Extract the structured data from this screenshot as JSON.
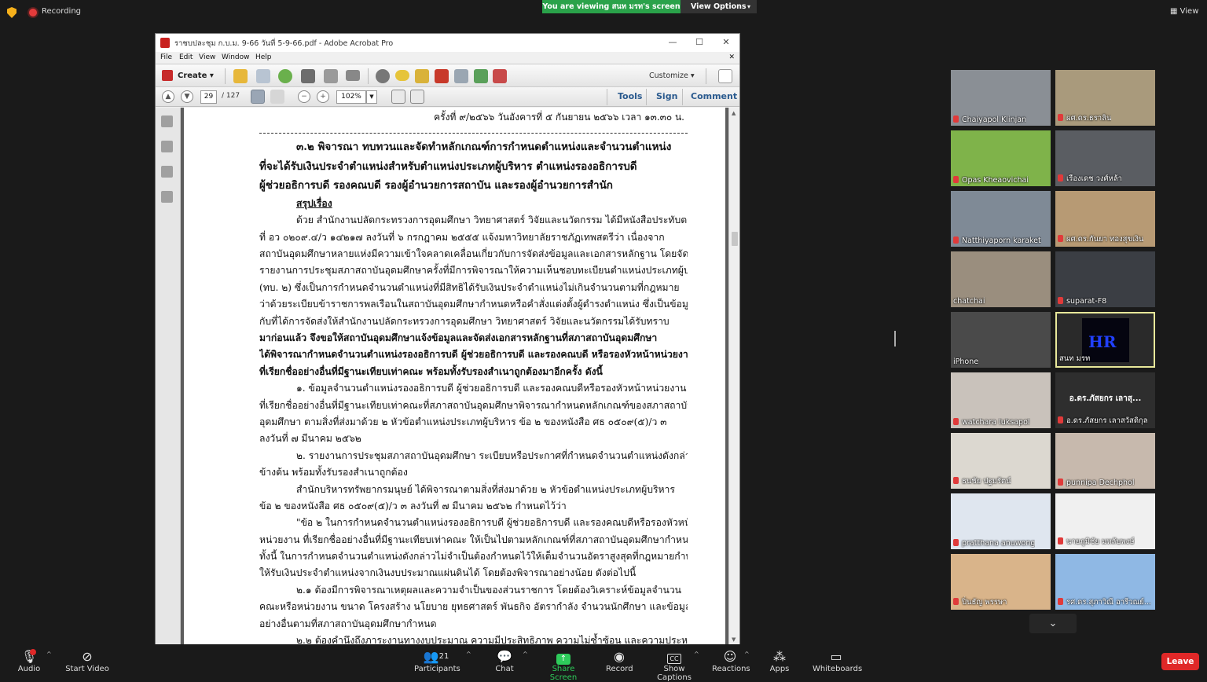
{
  "topbar": {
    "recording": "Recording",
    "viewing": "You are viewing สนท มรท's screen",
    "view_options": "View Options",
    "view": "View"
  },
  "acrobat": {
    "title": "ราชบปละชุม ก.บ.ม. 9-66 วันที่ 5-9-66.pdf - Adobe Acrobat Pro",
    "menu": [
      "File",
      "Edit",
      "View",
      "Window",
      "Help"
    ],
    "create": "Create",
    "customize": "Customize",
    "page_current": "29",
    "page_total": "/ 127",
    "zoom": "102%",
    "tabs": [
      "Tools",
      "Sign",
      "Comment"
    ]
  },
  "document": {
    "header": "ครั้งที่ ๙/๒๕๖๖ วันอังคารที่ ๕ กันยายน ๒๕๖๖ เวลา ๑๓.๓๐ น.",
    "heading": [
      "๓.๒   พิจารณา ทบทวนและจัดทำหลักเกณฑ์การกำหนดตำแหน่งและจำนวนตำแหน่ง",
      "ที่จะได้รับเงินประจำตำแหน่งสำหรับตำแหน่งประเภทผู้บริหาร ตำแหน่งรองอธิการบดี",
      "ผู้ช่วยอธิการบดี รองคณบดี รองผู้อำนวยการสถาบัน และรองผู้อำนวยการสำนัก"
    ],
    "summary_label": "สรุปเรื่อง",
    "lines": [
      "ด้วย สำนักงานปลัดกระทรวงการอุดมศึกษา วิทยาศาสตร์ วิจัยและนวัตกรรม ได้มีหนังสือประทับตรา",
      "ที่ อว ๐๒๐๙.๔/ว ๑๔๒๑๗ ลงวันที่ ๖ กรกฎาคม ๒๕๕๕ แจ้งมหาวิทยาลัยราชภัฏเทพสตรีว่า เนื่องจาก",
      "สถาบันอุดมศึกษาหลายแห่งมีความเข้าใจคลาดเคลื่อนเกี่ยวกับการจัดส่งข้อมูลและเอกสารหลักฐาน โดยจัดส่ง",
      "รายงานการประชุมสภาสถาบันอุดมศึกษาครั้งที่มีการพิจารณาให้ความเห็นชอบทะเบียนตำแหน่งประเภทผู้บริหาร",
      "(ทบ. ๒) ซึ่งเป็นการกำหนดจำนวนตำแหน่งที่มีสิทธิได้รับเงินประจำตำแหน่งไม่เกินจำนวนตามที่กฎหมาย",
      "ว่าด้วยระเบียบข้าราชการพลเรือนในสถาบันอุดมศึกษากำหนดหรือคำสั่งแต่งตั้งผู้ดำรงตำแหน่ง ซึ่งเป็นข้อมูลซ้ำ",
      "กับที่ได้การจัดส่งให้สำนักงานปลัดกระทรวงการอุดมศึกษา วิทยาศาสตร์ วิจัยและนวัตกรรมได้รับทราบ",
      "มาก่อนแล้ว จึงขอให้สถาบันอุดมศึกษาแจ้งข้อมูลและจัดส่งเอกสารหลักฐานที่สภาสถาบันอุดมศึกษา",
      "ได้พิจารณากำหนดจำนวนตำแหน่งรองอธิการบดี ผู้ช่วยอธิการบดี และรองคณบดี หรือรองหัวหน้าหน่วยงาน",
      "ที่เรียกชื่ออย่างอื่นที่มีฐานะเทียบเท่าคณะ พร้อมทั้งรับรองสำเนาถูกต้องมาอีกครั้ง ดังนี้",
      "๑. ข้อมูลจำนวนตำแหน่งรองอธิการบดี ผู้ช่วยอธิการบดี และรองคณบดีหรือรองหัวหน้าหน่วยงาน",
      "ที่เรียกชื่ออย่างอื่นที่มีฐานะเทียบเท่าคณะที่สภาสถาบันอุดมศึกษาพิจารณากำหนดหลักเกณฑ์ของสภาสถาบัน",
      "อุดมศึกษา ตามสิ่งที่ส่งมาด้วย ๒ หัวข้อตำแหน่งประเภทผู้บริหาร ข้อ ๒ ของหนังสือ ศธ ๐๕๐๙(๕)/ว ๓",
      "ลงวันที่ ๗ มีนาคม ๒๕๖๒",
      "๒. รายงานการประชุมสภาสถาบันอุดมศึกษา ระเบียบหรือประกาศที่กำหนดจำนวนตำแหน่งดังกล่าว",
      "ข้างต้น พร้อมทั้งรับรองสำเนาถูกต้อง",
      "สำนักบริหารทรัพยากรมนุษย์ ได้พิจารณาตามสิ่งที่ส่งมาด้วย ๒ หัวข้อตำแหน่งประเภทผู้บริหาร",
      "ข้อ ๒ ของหนังสือ ศธ ๐๕๐๙(๕)/ว ๓ ลงวันที่ ๗ มีนาคม ๒๕๖๒ กำหนดไว้ว่า",
      "\"ข้อ ๒ ในการกำหนดจำนวนตำแหน่งรองอธิการบดี ผู้ช่วยอธิการบดี และรองคณบดีหรือรองหัวหน้า",
      "หน่วยงาน ที่เรียกชื่ออย่างอื่นที่มีฐานะเทียบเท่าคณะ ให้เป็นไปตามหลักเกณฑ์ที่สภาสถาบันอุดมศึกษากำหนด",
      "ทั้งนี้ ในการกำหนดจำนวนตำแหน่งดังกล่าวไม่จำเป็นต้องกำหนดไว้ให้เต็มจำนวนอัตราสูงสุดที่กฎหมายกำหนด",
      "ให้รับเงินประจำตำแหน่งจากเงินงบประมาณแผ่นดินได้ โดยต้องพิจารณาอย่างน้อย ดังต่อไปนี้",
      "๒.๑ ต้องมีการพิจารณาเหตุผลและความจำเป็นของส่วนราชการ โดยต้องวิเคราะห์ข้อมูลจำนวน",
      "คณะหรือหน่วยงาน ขนาด โครงสร้าง นโยบาย ยุทธศาสตร์ พันธกิจ อัตรากำลัง จำนวนนักศึกษา และข้อมูลจำเป็น",
      "อย่างอื่นตามที่สภาสถาบันอุดมศึกษากำหนด",
      "๒.๒ ต้องคำนึงถึงภาระงานทางงบประมาณ ความมีประสิทธิภาพ ความไม่ซ้ำซ้อน และความประหยัด"
    ]
  },
  "participants": [
    {
      "name": "Chaiyapol Klinjan",
      "color": "#8a8f95"
    },
    {
      "name": "ผศ.ดร.ธราลิน",
      "color": "#a99a7c"
    },
    {
      "name": "Opas Kheaovichai",
      "color": "#7fb34a"
    },
    {
      "name": "เรืองเดช วงศ์หล้า",
      "color": "#5a5d62"
    },
    {
      "name": "Natthiyaporn karaket",
      "color": "#7f8a96"
    },
    {
      "name": "ผศ.ดร.กันยา ทองสุขเงิน",
      "color": "#b79a74"
    },
    {
      "name": "chatchai",
      "color": "#9a8e7e"
    },
    {
      "name": "suparat-F8",
      "color": "#3b3e44"
    },
    {
      "name": "iPhone",
      "color": "#4a4a4a"
    },
    {
      "name": "สนท มรท",
      "color": "#2a2a2a",
      "logo": "HR",
      "active": true
    },
    {
      "name": "watchara luksapol",
      "color": "#c9c2bb"
    },
    {
      "name": "อ.ดร.ภัสยกร เลาสุ...",
      "full": "อ.ดร.ภัสยกร เลาสวัสดิกุล",
      "color": "#2e2e2e",
      "text_tile": true
    },
    {
      "name": "ธนชัย ปฐมรัตน์",
      "color": "#dcd8d0"
    },
    {
      "name": "punnipa Dechphol",
      "color": "#c7b9ad"
    },
    {
      "name": "pratthana anuwong",
      "color": "#dfe6ef"
    },
    {
      "name": "นายภูมิชัย มหลับพงษ์",
      "color": "#f0f0f0"
    },
    {
      "name": "ปิ่นธัญ พรรษา",
      "color": "#d9b48a"
    },
    {
      "name": "รศ.ดร.สุภาวิณี อารีวณย์...",
      "color": "#8fb8e4"
    }
  ],
  "bottombar": {
    "audio": "Audio",
    "video": "Start Video",
    "participants": "Participants",
    "participants_count": "21",
    "chat": "Chat",
    "share": "Share Screen",
    "record": "Record",
    "captions": "Show Captions",
    "reactions": "Reactions",
    "apps": "Apps",
    "whiteboards": "Whiteboards",
    "leave": "Leave"
  },
  "colors": {
    "viewing_bar": "#2aa24a",
    "leave": "#e02828",
    "acrobat_red": "#c8201e",
    "active_speaker_border": "#e8e89a"
  }
}
